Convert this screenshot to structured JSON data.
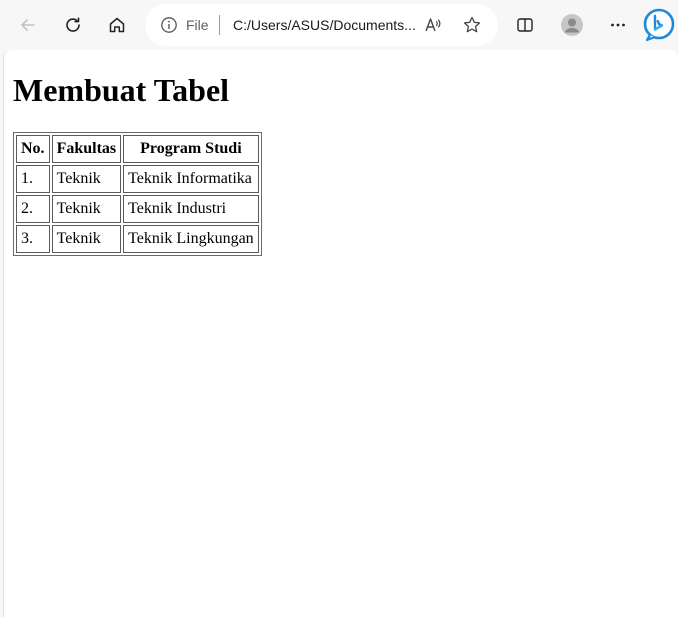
{
  "browser": {
    "address": {
      "scheme": "File",
      "url": "C:/Users/ASUS/Documents..."
    },
    "icons": {
      "back": "back-arrow-icon",
      "refresh": "refresh-icon",
      "home": "home-icon",
      "info": "info-icon",
      "read_aloud": "read-aloud-icon",
      "favorite": "star-icon",
      "split_screen": "split-screen-icon",
      "profile": "profile-avatar-icon",
      "menu": "more-menu-icon",
      "copilot": "bing-copilot-icon"
    },
    "colors": {
      "toolbar_bg": "#f7f7f7",
      "address_bg": "#ffffff",
      "copilot_accent": "#1c8ad8"
    }
  },
  "page": {
    "heading": "Membuat Tabel",
    "table": {
      "headers": [
        "No.",
        "Fakultas",
        "Program Studi"
      ],
      "rows": [
        [
          "1.",
          "Teknik",
          "Teknik Informatika"
        ],
        [
          "2.",
          "Teknik",
          "Teknik Industri"
        ],
        [
          "3.",
          "Teknik",
          "Teknik Lingkungan"
        ]
      ]
    }
  }
}
